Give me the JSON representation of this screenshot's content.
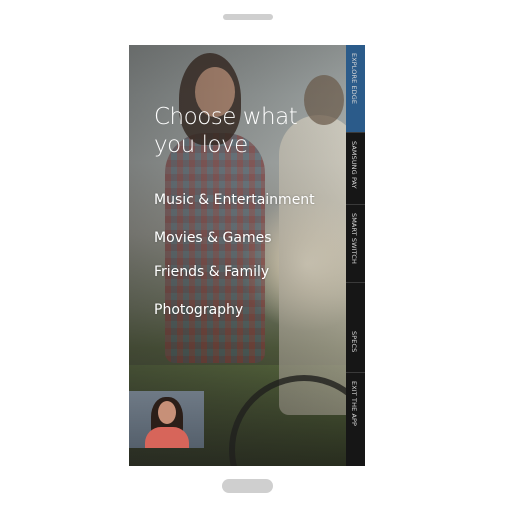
{
  "device": {
    "accent_color": "#2b5b8a",
    "frame_color": "#cfcfcf"
  },
  "menu": {
    "title_line1": "Choose what",
    "title_line2": "you love",
    "items": [
      {
        "label": "Music & Entertainment"
      },
      {
        "label": "Movies & Games"
      },
      {
        "label": "Friends & Family"
      },
      {
        "label": "Photography"
      }
    ]
  },
  "tabs": [
    {
      "label": "EXPLORE EDGE",
      "active": true
    },
    {
      "label": "SAMSUNG PAY",
      "active": false
    },
    {
      "label": "SMART SWITCH",
      "active": false
    },
    {
      "label": "SPECS",
      "active": false
    },
    {
      "label": "EXIT THE APP",
      "active": false
    }
  ],
  "video_thumbnail": {
    "icon": "presenter-video-thumbnail"
  }
}
